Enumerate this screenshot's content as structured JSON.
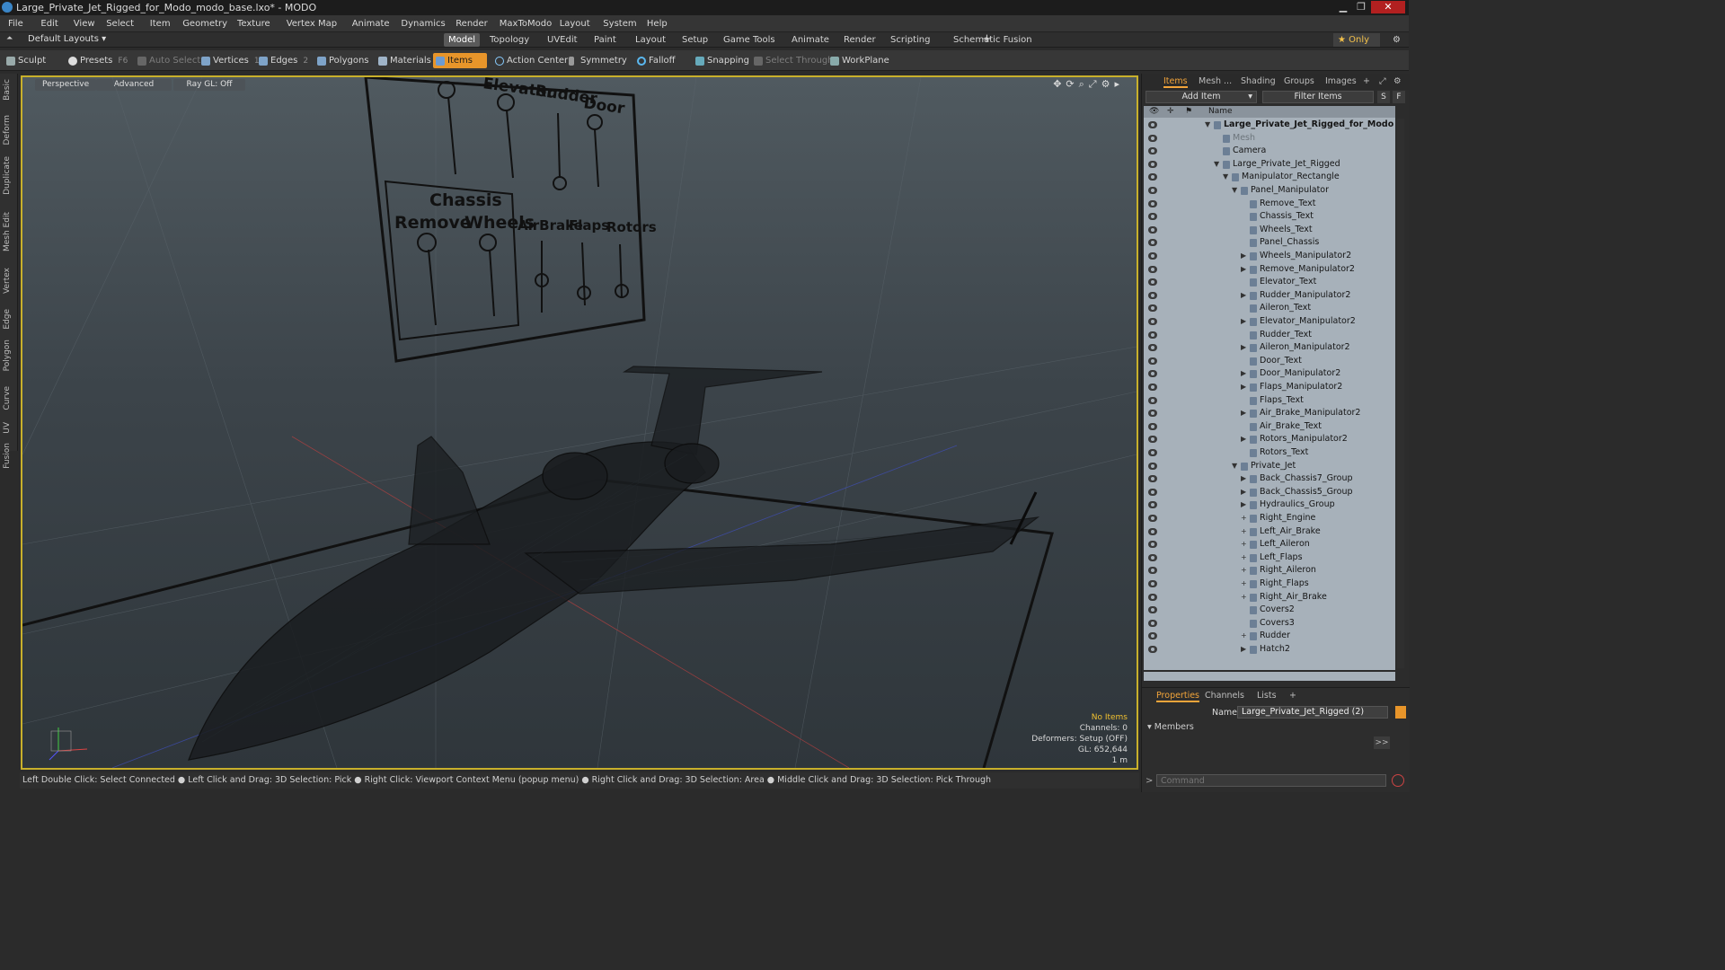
{
  "window": {
    "title": "Large_Private_Jet_Rigged_for_Modo_modo_base.lxo* - MODO"
  },
  "menu": [
    "File",
    "Edit",
    "View",
    "Select",
    "Item",
    "Geometry",
    "Texture",
    "Vertex Map",
    "Animate",
    "Dynamics",
    "Render",
    "MaxToModo",
    "Layout",
    "System",
    "Help"
  ],
  "layouts": {
    "label": "Default Layouts ▾"
  },
  "tabs": [
    "Model",
    "Topology",
    "UVEdit",
    "Paint",
    "Layout",
    "Setup",
    "Game Tools",
    "Animate",
    "Render",
    "Scripting",
    "Schematic Fusion"
  ],
  "tabs_active": "Model",
  "only_label": "★ Only",
  "toolbar": {
    "sculpt": "Sculpt",
    "presets": "Presets",
    "presets_key": "F6",
    "auto_select": "Auto Select",
    "vertices": "Vertices",
    "vertices_count": "1",
    "edges": "Edges",
    "edges_count": "2",
    "polygons": "Polygons",
    "materials": "Materials",
    "items": "Items",
    "action_center": "Action Center",
    "symmetry": "Symmetry",
    "falloff": "Falloff",
    "snapping": "Snapping",
    "select_through": "Select Through",
    "workplane": "WorkPlane"
  },
  "left_tabs": [
    "Basic",
    "Deform",
    "Duplicate",
    "Mesh Edit",
    "Vertex",
    "Edge",
    "Polygon",
    "Curve",
    "UV",
    "Fusion"
  ],
  "viewport": {
    "perspective": "Perspective",
    "advanced": "Advanced",
    "raygl": "Ray GL: Off",
    "panel_labels": [
      "Elevator",
      "Rudder",
      "Door",
      "Chassis",
      "Remove",
      "Wheels",
      "AirBrake",
      "Flaps",
      "Rotors"
    ],
    "info": {
      "no_items": "No Items",
      "channels": "Channels: 0",
      "deformers": "Deformers: Setup (OFF)",
      "gl": "GL: 652,644",
      "scale": "1 m"
    }
  },
  "status": "Left Double Click: Select Connected ● Left Click and Drag: 3D Selection: Pick ● Right Click: Viewport Context Menu (popup menu) ● Right Click and Drag: 3D Selection: Area ● Middle Click and Drag: 3D Selection: Pick Through",
  "right_panel": {
    "tabs": [
      "Items",
      "Mesh ...",
      "Shading",
      "Groups",
      "Images"
    ],
    "add_item": "Add Item",
    "filter_items": "Filter Items",
    "filter_s": "S",
    "filter_f": "F",
    "col_name": "Name",
    "items": [
      {
        "label": "Large_Private_Jet_Rigged_for_Modo ...",
        "depth": 0,
        "tri": "▼",
        "bold": true
      },
      {
        "label": "Mesh",
        "depth": 1,
        "tri": "",
        "dim": true
      },
      {
        "label": "Camera",
        "depth": 1,
        "tri": ""
      },
      {
        "label": "Large_Private_Jet_Rigged",
        "depth": 1,
        "tri": "▼"
      },
      {
        "label": "Manipulator_Rectangle",
        "depth": 2,
        "tri": "▼"
      },
      {
        "label": "Panel_Manipulator",
        "depth": 3,
        "tri": "▼"
      },
      {
        "label": "Remove_Text",
        "depth": 4,
        "tri": ""
      },
      {
        "label": "Chassis_Text",
        "depth": 4,
        "tri": ""
      },
      {
        "label": "Wheels_Text",
        "depth": 4,
        "tri": ""
      },
      {
        "label": "Panel_Chassis",
        "depth": 4,
        "tri": ""
      },
      {
        "label": "Wheels_Manipulator2",
        "depth": 4,
        "tri": "▶"
      },
      {
        "label": "Remove_Manipulator2",
        "depth": 4,
        "tri": "▶"
      },
      {
        "label": "Elevator_Text",
        "depth": 4,
        "tri": ""
      },
      {
        "label": "Rudder_Manipulator2",
        "depth": 4,
        "tri": "▶"
      },
      {
        "label": "Aileron_Text",
        "depth": 4,
        "tri": ""
      },
      {
        "label": "Elevator_Manipulator2",
        "depth": 4,
        "tri": "▶"
      },
      {
        "label": "Rudder_Text",
        "depth": 4,
        "tri": ""
      },
      {
        "label": "Aileron_Manipulator2",
        "depth": 4,
        "tri": "▶"
      },
      {
        "label": "Door_Text",
        "depth": 4,
        "tri": ""
      },
      {
        "label": "Door_Manipulator2",
        "depth": 4,
        "tri": "▶"
      },
      {
        "label": "Flaps_Manipulator2",
        "depth": 4,
        "tri": "▶"
      },
      {
        "label": "Flaps_Text",
        "depth": 4,
        "tri": ""
      },
      {
        "label": "Air_Brake_Manipulator2",
        "depth": 4,
        "tri": "▶"
      },
      {
        "label": "Air_Brake_Text",
        "depth": 4,
        "tri": ""
      },
      {
        "label": "Rotors_Manipulator2",
        "depth": 4,
        "tri": "▶"
      },
      {
        "label": "Rotors_Text",
        "depth": 4,
        "tri": ""
      },
      {
        "label": "Private_Jet",
        "depth": 3,
        "tri": "▼"
      },
      {
        "label": "Back_Chassis7_Group",
        "depth": 4,
        "tri": "▶"
      },
      {
        "label": "Back_Chassis5_Group",
        "depth": 4,
        "tri": "▶"
      },
      {
        "label": "Hydraulics_Group",
        "depth": 4,
        "tri": "▶"
      },
      {
        "label": "Right_Engine",
        "depth": 4,
        "tri": "+"
      },
      {
        "label": "Left_Air_Brake",
        "depth": 4,
        "tri": "+"
      },
      {
        "label": "Left_Aileron",
        "depth": 4,
        "tri": "+"
      },
      {
        "label": "Left_Flaps",
        "depth": 4,
        "tri": "+"
      },
      {
        "label": "Right_Aileron",
        "depth": 4,
        "tri": "+"
      },
      {
        "label": "Right_Flaps",
        "depth": 4,
        "tri": "+"
      },
      {
        "label": "Right_Air_Brake",
        "depth": 4,
        "tri": "+"
      },
      {
        "label": "Covers2",
        "depth": 4,
        "tri": ""
      },
      {
        "label": "Covers3",
        "depth": 4,
        "tri": ""
      },
      {
        "label": "Rudder",
        "depth": 4,
        "tri": "+"
      },
      {
        "label": "Hatch2",
        "depth": 4,
        "tri": "▶"
      }
    ],
    "props_tabs": [
      "Properties",
      "Channels",
      "Lists"
    ],
    "name_label": "Name",
    "name_value": "Large_Private_Jet_Rigged (2)",
    "members": "Members",
    "command_placeholder": "Command"
  },
  "colors": {
    "accent": "#e8952a",
    "viewport_border": "#c8b02b",
    "list_bg": "#a7b1ba"
  }
}
